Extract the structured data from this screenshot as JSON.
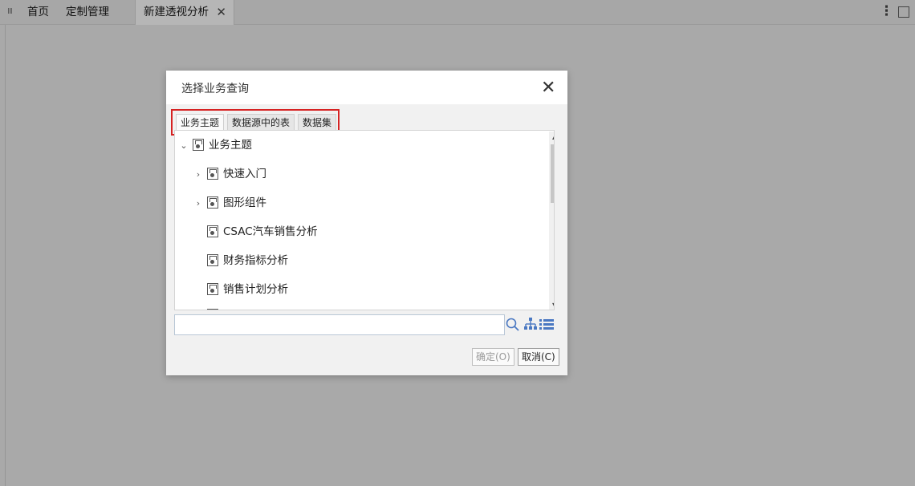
{
  "tabbar": {
    "grip": "III",
    "tabs": [
      {
        "label": "首页"
      },
      {
        "label": "定制管理"
      },
      {
        "label": "新建透视分析"
      }
    ],
    "close_glyph": "✕",
    "more_glyph": "⋮"
  },
  "dialog": {
    "title": "选择业务查询",
    "close_glyph": "✕",
    "subtabs": [
      "业务主题",
      "数据源中的表",
      "数据集"
    ],
    "tree": {
      "root": "业务主题",
      "items": [
        "快速入门",
        "图形组件",
        "CSAC汽车销售分析",
        "财务指标分析",
        "销售计划分析"
      ]
    },
    "search": {
      "value": "",
      "placeholder": ""
    },
    "buttons": {
      "ok": "确定(O)",
      "cancel": "取消(C)"
    }
  },
  "colors": {
    "highlight": "#d62222",
    "accent_icon": "#4a78c2"
  },
  "icons": [
    "expand-chevron-icon",
    "collapse-chevron-icon",
    "folder-node-icon",
    "search-icon",
    "tree-view-icon",
    "list-view-icon",
    "close-icon",
    "more-icon",
    "maximize-icon"
  ]
}
